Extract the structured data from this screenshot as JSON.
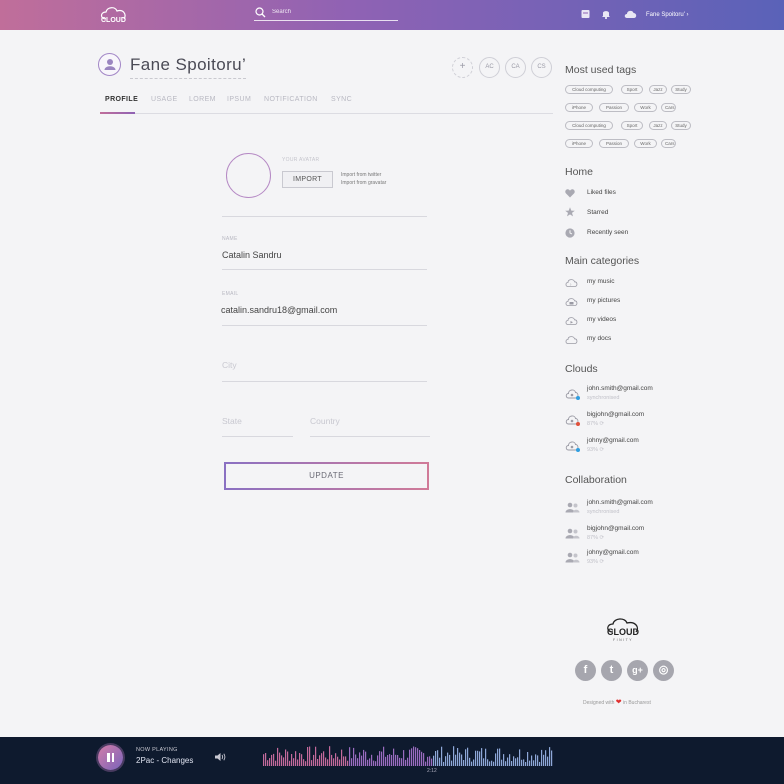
{
  "topbar": {
    "logo_text": "CLOUD",
    "search_placeholder": "Search",
    "user_name": "Fane Spoitoru' ›",
    "gradient": [
      "#c06e9a",
      "#8f62b4",
      "#5a62b8"
    ]
  },
  "profile": {
    "name": "Fane Spoitoru’",
    "add_label": "+",
    "collaborators": [
      "AC",
      "CA",
      "CS"
    ]
  },
  "tabs": [
    {
      "label": "PROFILE",
      "active": true
    },
    {
      "label": "USAGE"
    },
    {
      "label": "LOREM"
    },
    {
      "label": "IPSUM"
    },
    {
      "label": "NOTIFICATION"
    },
    {
      "label": "SYNC"
    }
  ],
  "form": {
    "your_avatar_label": "YOUR AVATAR",
    "import_button": "IMPORT",
    "import_twitter": "Import from twitter",
    "import_gravatar": "Import from gravatar",
    "name_label": "NAME",
    "name_value": "Catalin Sandru",
    "email_label": "EMAIL",
    "email_value": "catalin.sandru18@gmail.com",
    "city_placeholder": "City",
    "state_placeholder": "State",
    "country_placeholder": "Country",
    "update_button": "UPDATE"
  },
  "sidebar": {
    "tags_title": "Most used tags",
    "tag_rows": [
      [
        "Cloud computing",
        "Sport",
        "Jazz",
        "Study"
      ],
      [
        "iPhone",
        "Passion",
        "Work",
        "Cars"
      ],
      [
        "Cloud computing",
        "Sport",
        "Jazz",
        "Study"
      ],
      [
        "iPhone",
        "Passion",
        "Work",
        "Cars"
      ]
    ],
    "home_title": "Home",
    "home_items": [
      {
        "label": "Liked files",
        "icon": "heart-icon"
      },
      {
        "label": "Starred",
        "icon": "star-icon"
      },
      {
        "label": "Recently seen",
        "icon": "clock-icon"
      }
    ],
    "categories_title": "Main categories",
    "categories": [
      {
        "label": "my music",
        "icon": "cloud-music-icon"
      },
      {
        "label": "my pictures",
        "icon": "cloud-camera-icon"
      },
      {
        "label": "my videos",
        "icon": "cloud-video-icon"
      },
      {
        "label": "my docs",
        "icon": "cloud-icon"
      }
    ],
    "clouds_title": "Clouds",
    "clouds": [
      {
        "email": "john.smith@gmail.com",
        "status": "synchronised",
        "dot": "#2f9ee0"
      },
      {
        "email": "bigjohn@gmail.com",
        "status": "87% ⟳",
        "dot": "#e0503a"
      },
      {
        "email": "johny@gmail.com",
        "status": "93% ⟳",
        "dot": "#2f9ee0"
      }
    ],
    "collab_title": "Collaboration",
    "collaboration": [
      {
        "email": "john.smith@gmail.com",
        "status": "synchronised"
      },
      {
        "email": "bigjohn@gmail.com",
        "status": "87% ⟳"
      },
      {
        "email": "johny@gmail.com",
        "status": "93% ⟳"
      }
    ],
    "footer_logo_text": "CLOUD",
    "footer_logo_sub": "FINITY",
    "social": [
      {
        "label": "f",
        "icon": "facebook-icon"
      },
      {
        "label": "t",
        "icon": "twitter-icon"
      },
      {
        "label": "g+",
        "icon": "google-plus-icon"
      },
      {
        "label": "◎",
        "icon": "instagram-icon"
      }
    ],
    "designed_before": "Designed with",
    "designed_heart": "❤",
    "designed_after": "in Bucharest"
  },
  "player": {
    "now_playing_label": "NOW PLAYING",
    "track": "2Pac - Changes",
    "time": "2:12",
    "progress": 0.58
  }
}
